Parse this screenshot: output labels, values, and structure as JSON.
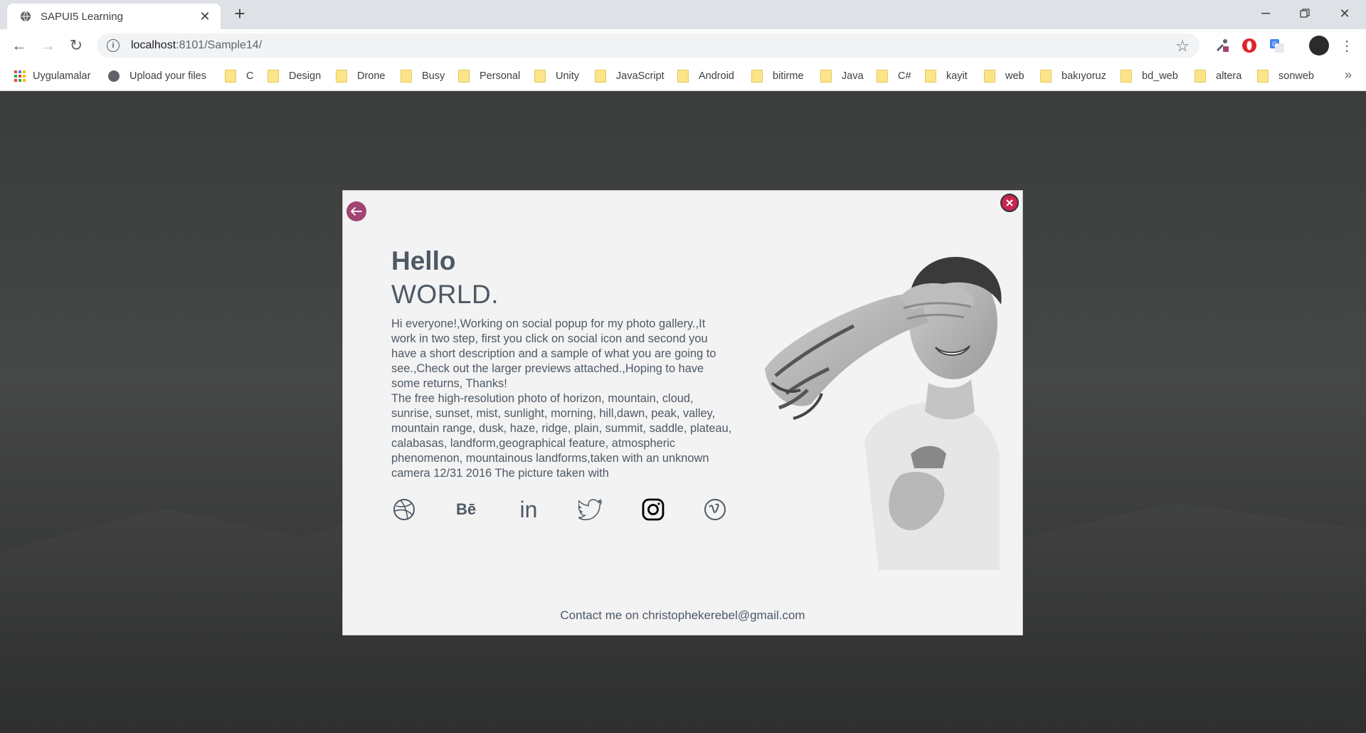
{
  "browser": {
    "tab_title": "SAPUI5 Learning",
    "url_host": "localhost",
    "url_rest": ":8101/Sample14/"
  },
  "bookmarks": {
    "apps_label": "Uygulamalar",
    "upload_label": "Upload your files",
    "folders": [
      "C",
      "Design",
      "Drone",
      "Busy",
      "Personal",
      "Unity",
      "JavaScript",
      "Android",
      "bitirme",
      "Java",
      "C#",
      "kayit",
      "web",
      "bakıyoruz",
      "bd_web",
      "altera",
      "sonweb"
    ],
    "more": "»"
  },
  "dialog": {
    "heading_line1": "Hello",
    "heading_line2": "WORLD.",
    "paragraph1": "Hi everyone!,Working on social popup for my photo gallery.,It work in two step, first you click on social icon and second you have a short description and a sample of what you are going to see.,Check out the larger previews attached.,Hoping to have some returns, Thanks!",
    "paragraph2": "The free high-resolution photo of horizon, mountain, cloud, sunrise, sunset, mist, sunlight, morning, hill,dawn, peak, valley, mountain range, dusk, haze, ridge, plain, summit, saddle, plateau, calabasas, landform,geographical feature, atmospheric phenomenon, mountainous landforms,taken with an unknown camera 12/31 2016 The picture taken with",
    "contact": "Contact me on christophekerebel@gmail.com",
    "social_icons": [
      "dribbble-icon",
      "behance-icon",
      "linkedin-icon",
      "twitter-icon",
      "instagram-icon",
      "vimeo-icon"
    ],
    "behance_text": "Bē",
    "linkedin_text": "in"
  },
  "colors": {
    "back_button": "#a14472",
    "close_button": "#c8254f",
    "text": "#4e5965",
    "dialog_bg": "#f3f3f3"
  }
}
